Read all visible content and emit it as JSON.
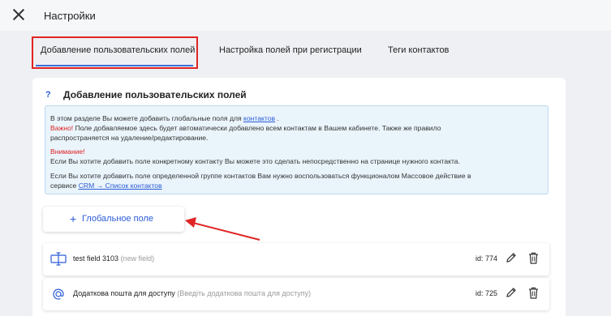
{
  "header": {
    "title": "Настройки"
  },
  "tabs": [
    {
      "label": "Добавление пользовательских полей"
    },
    {
      "label": "Настройка полей при регистрации"
    },
    {
      "label": "Теги контактов"
    }
  ],
  "section": {
    "help": "?",
    "title": "Добавление пользовательских полей"
  },
  "info": {
    "line1_text": "В этом разделе Вы можете добавить глобальные поля для ",
    "line1_link": "контактов",
    "line1_end": " .",
    "line2_warn": "Важно!",
    "line2_text": " Поле добавляемое здесь будет автоматически добавлено всем контактам в Вашем кабинете. Также же правило",
    "line3": "распространяется на удаление/редактирование.",
    "attention": "Внимание!",
    "line5": "Если Вы хотите добавить поле конкретному контакту Вы можете это сделать непосредственно на странице нужного контакта.",
    "line6": "Если Вы хотите добавить поле определенной группе контактов Вам нужно воспользоваться функционалом Массовое действие в",
    "line7_text": "сервисе ",
    "line7_link": "CRM → Список контактов"
  },
  "add_button": {
    "plus": "+",
    "label": "Глобальное поле"
  },
  "fields": [
    {
      "name": "test field 3103",
      "hint": "(new field)",
      "id": "id: 774",
      "icon": "text-field-icon"
    },
    {
      "name": "Додаткова пошта для доступу",
      "hint": "(Введіть додаткова пошта для доступу)",
      "id": "id: 725",
      "icon": "at-sign-icon"
    }
  ],
  "colors": {
    "accent": "#2a5bd7",
    "highlight": "#e02424",
    "info_bg": "#eaf4fb"
  }
}
